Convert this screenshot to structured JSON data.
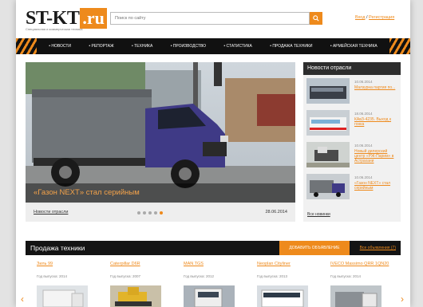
{
  "header": {
    "logo_main": "ST-KT",
    "logo_ru": ".ru",
    "logo_tagline": "Специальная и коммерческая техника",
    "search_placeholder": "Поиск по сайту",
    "login_label": "Вход",
    "auth_separator": " / ",
    "register_label": "Регистрация"
  },
  "nav": {
    "items": [
      "• НОВОСТИ",
      "• РЕПОРТАЖ",
      "• ТЕХНИКА",
      "• ПРОИЗВОДСТВО",
      "• СТАТИСТИКА",
      "• ПРОДАЖА ТЕХНИКИ",
      "• АРМЕЙСКАЯ ТЕХНИКА"
    ]
  },
  "hero": {
    "title": "«Газон NEXT» стал серийным",
    "category": "Новости отрасли",
    "date": "28.06.2014",
    "slides": 5,
    "active_slide": 5
  },
  "news": {
    "heading": "Новости отрасли",
    "items": [
      {
        "date": "10.06.2014",
        "text": "Малзурна партия по..."
      },
      {
        "date": "18.06.2014",
        "text": "КАвЗ-4235. Выход к гонка"
      },
      {
        "date": "10.06.2014",
        "text": "Новый дилерский центр «РЖ-Парим» в Астрахани"
      },
      {
        "date": "10.06.2014",
        "text": "«Газон NEXT» стал серийным"
      }
    ],
    "all_link": "Все новинки"
  },
  "sale": {
    "heading": "Продажа техники",
    "add_button": "ДОБАВИТЬ ОБЪЯВЛЕНИЕ",
    "all_link": "Все объявления (7)",
    "items": [
      {
        "name": "Зиль 99",
        "year": "Год выпуска: 2014"
      },
      {
        "name": "Caterpillar D6R",
        "year": "Год выпуска: 2007"
      },
      {
        "name": "MAN TGS",
        "year": "Год выпуска: 2012"
      },
      {
        "name": "Neoplan Cityliner",
        "year": "Год выпуска: 2013"
      },
      {
        "name": "IVECO Massimo QRR 1QN20",
        "year": "Год выпуска: 2014"
      }
    ]
  },
  "colors": {
    "accent": "#ee8a1c",
    "nav_bg": "#111111",
    "panel_head": "#2d2d2d"
  }
}
